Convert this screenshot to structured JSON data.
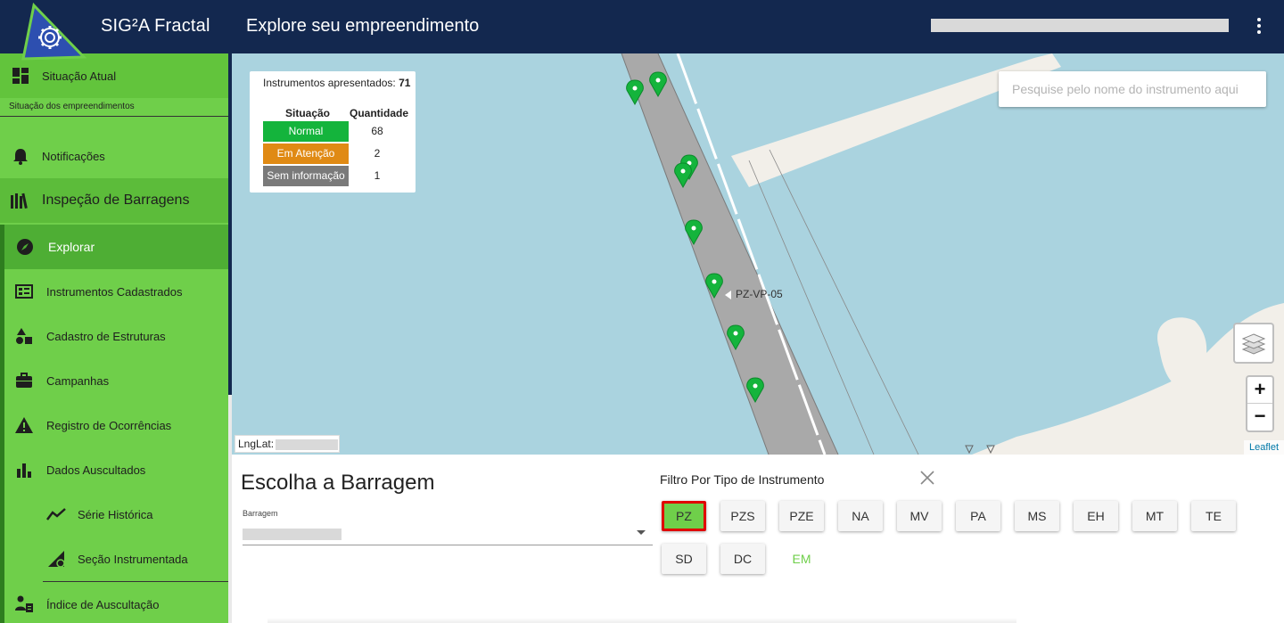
{
  "header": {
    "app_title": "SIG²A Fractal",
    "page_title": "Explore seu empreendimento",
    "logo_icon": "gear-triangle-logo-icon",
    "menu_icon": "kebab-menu-icon"
  },
  "sidebar": {
    "situacao": {
      "label": "Situação Atual",
      "sub": "Situação dos empreendimentos",
      "icon": "dashboard-icon"
    },
    "notificacoes": {
      "label": "Notificações",
      "icon": "bell-icon"
    },
    "inspecao": {
      "label": "Inspeção de Barragens",
      "icon": "books-icon"
    },
    "items": [
      {
        "label": "Explorar",
        "icon": "compass-icon"
      },
      {
        "label": "Instrumentos Cadastrados",
        "icon": "chart-grid-icon"
      },
      {
        "label": "Cadastro de Estruturas",
        "icon": "shapes-icon"
      },
      {
        "label": "Campanhas",
        "icon": "briefcase-icon"
      },
      {
        "label": "Registro de Ocorrências",
        "icon": "warning-icon"
      },
      {
        "label": "Dados Auscultados",
        "icon": "bar-chart-icon"
      },
      {
        "label": "Série Histórica",
        "icon": "line-chart-icon"
      },
      {
        "label": "Seção Instrumentada",
        "icon": "triangle-gear-icon"
      },
      {
        "label": "Índice de Auscultação",
        "icon": "person-document-icon"
      }
    ]
  },
  "map": {
    "legend": {
      "title": "Instrumentos apresentados:",
      "total": "71",
      "col_situacao": "Situação",
      "col_quantidade": "Quantidade",
      "rows": [
        {
          "label": "Normal",
          "count": "68",
          "color": "#14b43c"
        },
        {
          "label": "Em Atenção",
          "count": "2",
          "color": "#e08a14"
        },
        {
          "label": "Sem informação",
          "count": "1",
          "color": "#7a7a7a"
        }
      ]
    },
    "search_placeholder": "Pesquise pelo nome do instrumento aqui",
    "pin_label": "PZ-VP-05",
    "lnglat_label": "LngLat:",
    "zoom_in": "+",
    "zoom_out": "−",
    "attribution": "Leaflet",
    "colors": {
      "water": "#aad3df",
      "land": "#f2efe9",
      "road": "#a9a9a9",
      "pin": "#14b43c"
    }
  },
  "chooser": {
    "title": "Escolha a Barragem",
    "field_label": "Barragem"
  },
  "filter": {
    "title": "Filtro Por Tipo de Instrumento",
    "close_icon": "close-x-icon",
    "chips": [
      "PZ",
      "PZS",
      "PZE",
      "NA",
      "MV",
      "PA",
      "MS",
      "EH",
      "MT",
      "TE",
      "SD",
      "DC",
      "EM"
    ],
    "active": "PZ"
  }
}
